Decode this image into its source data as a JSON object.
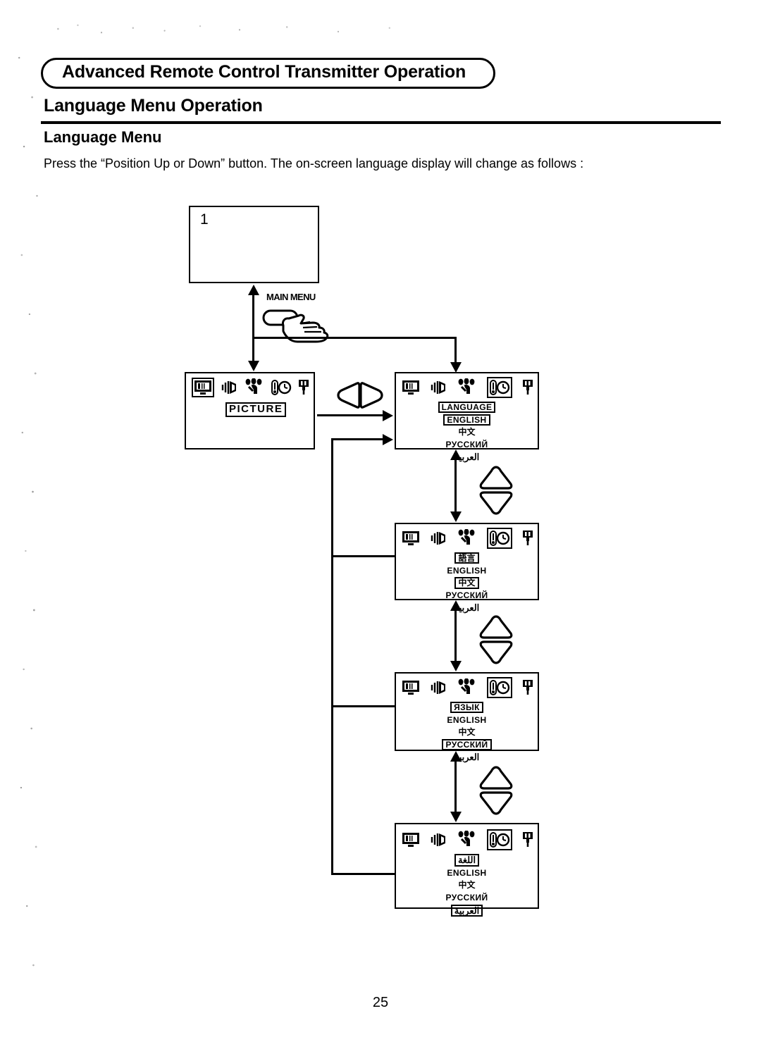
{
  "page": {
    "header_pill_title": "Advanced Remote Control Transmitter Operation",
    "section_title": "Language Menu Operation",
    "subsection_title": "Language Menu",
    "instruction": "Press the “Position Up or Down” button. The on-screen language display will change as follows :",
    "page_number": "25"
  },
  "diagram": {
    "screen1": {
      "number": "1"
    },
    "main_menu_button": {
      "label": "MAIN MENU",
      "icon": "hand-pressing-button-icon"
    },
    "nav_hints": {
      "left_right": "left-right-rocker-icon",
      "up_down": "up-down-rocker-icon"
    },
    "menu_icons": [
      {
        "name": "picture-icon",
        "label": "picture"
      },
      {
        "name": "audio-speaker-icon",
        "label": "audio"
      },
      {
        "name": "hand-setup-icon",
        "label": "setup"
      },
      {
        "name": "timer-clock-icon",
        "label": "timer"
      },
      {
        "name": "plug-input-icon",
        "label": "input"
      }
    ],
    "screens": [
      {
        "id": "picture-menu",
        "selected_icon_index": 0,
        "title": "PICTURE",
        "title_boxed": true,
        "items": []
      },
      {
        "id": "language-menu-english",
        "selected_icon_index": 3,
        "title": "LANGUAGE",
        "title_boxed": true,
        "items": [
          {
            "text": "ENGLISH",
            "selected": true,
            "script": "latin"
          },
          {
            "text": "中文",
            "selected": false,
            "script": "cjk"
          },
          {
            "text": "РУССКИЙ",
            "selected": false,
            "script": "cyrillic"
          },
          {
            "text": "العربية",
            "selected": false,
            "script": "arabic"
          }
        ]
      },
      {
        "id": "language-menu-chinese",
        "selected_icon_index": 3,
        "title": "語言",
        "title_boxed": true,
        "items": [
          {
            "text": "ENGLISH",
            "selected": false,
            "script": "latin"
          },
          {
            "text": "中文",
            "selected": true,
            "script": "cjk"
          },
          {
            "text": "РУССКИЙ",
            "selected": false,
            "script": "cyrillic"
          },
          {
            "text": "العربية",
            "selected": false,
            "script": "arabic"
          }
        ]
      },
      {
        "id": "language-menu-russian",
        "selected_icon_index": 3,
        "title": "ЯЗЫК",
        "title_boxed": true,
        "items": [
          {
            "text": "ENGLISH",
            "selected": false,
            "script": "latin"
          },
          {
            "text": "中文",
            "selected": false,
            "script": "cjk"
          },
          {
            "text": "РУССКИЙ",
            "selected": true,
            "script": "cyrillic"
          },
          {
            "text": "العربية",
            "selected": false,
            "script": "arabic"
          }
        ]
      },
      {
        "id": "language-menu-arabic",
        "selected_icon_index": 3,
        "title": "اللغة",
        "title_boxed": true,
        "items": [
          {
            "text": "ENGLISH",
            "selected": false,
            "script": "latin"
          },
          {
            "text": "中文",
            "selected": false,
            "script": "cjk"
          },
          {
            "text": "РУССКИЙ",
            "selected": false,
            "script": "cyrillic"
          },
          {
            "text": "العربية",
            "selected": true,
            "script": "arabic"
          }
        ]
      }
    ]
  },
  "colors": {
    "ink": "#000000",
    "paper": "#ffffff"
  }
}
